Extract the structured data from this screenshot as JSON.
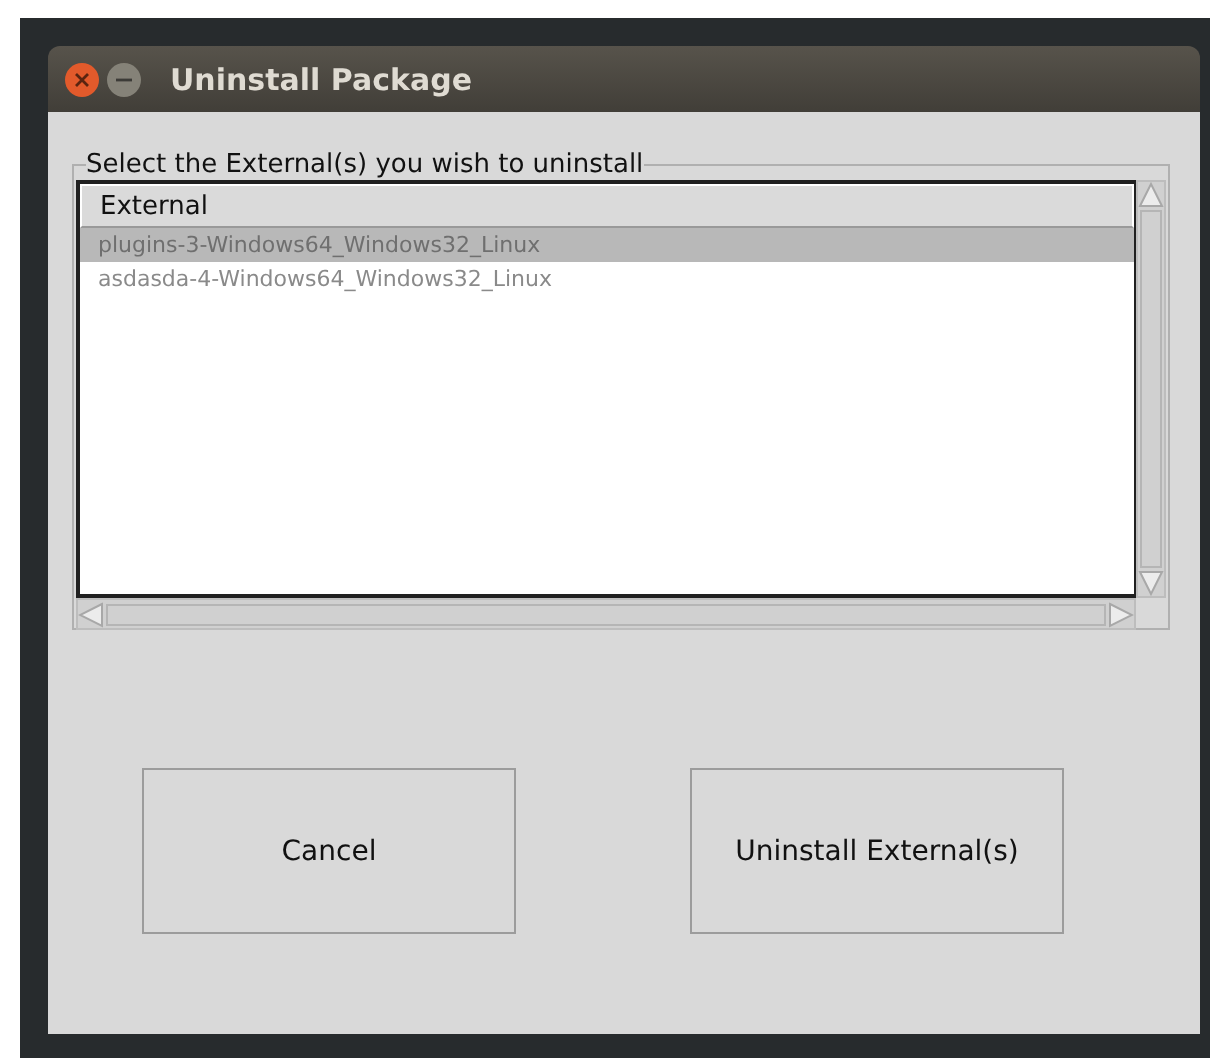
{
  "window": {
    "title": "Uninstall Package"
  },
  "group": {
    "label": "Select the External(s) you wish to uninstall"
  },
  "table": {
    "columns": [
      "External"
    ],
    "rows": [
      {
        "cells": [
          "plugins-3-Windows64_Windows32_Linux"
        ],
        "selected": true
      },
      {
        "cells": [
          "asdasda-4-Windows64_Windows32_Linux"
        ],
        "selected": false
      }
    ]
  },
  "buttons": [
    "Cancel",
    "Uninstall External(s)"
  ]
}
